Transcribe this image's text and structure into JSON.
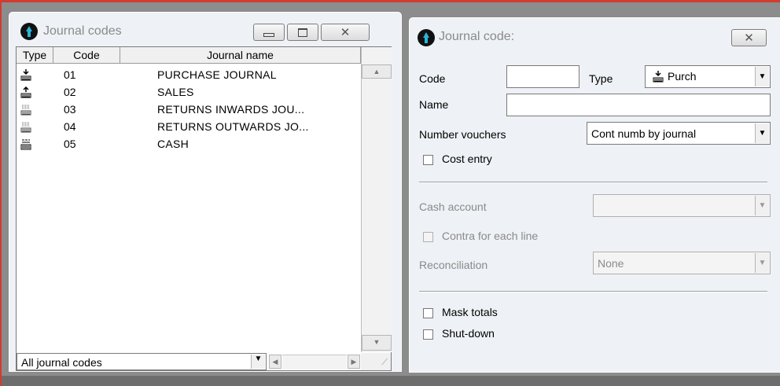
{
  "left_window": {
    "title": "Journal codes",
    "columns": [
      "Type",
      "Code",
      "Journal name"
    ],
    "rows": [
      {
        "icon": "purchase-icon",
        "code": "01",
        "name": "PURCHASE JOURNAL"
      },
      {
        "icon": "sales-icon",
        "code": "02",
        "name": "SALES"
      },
      {
        "icon": "returns-icon",
        "code": "03",
        "name": "RETURNS INWARDS JOU..."
      },
      {
        "icon": "returns-icon",
        "code": "04",
        "name": "RETURNS OUTWARDS JO..."
      },
      {
        "icon": "cash-icon",
        "code": "05",
        "name": "CASH"
      }
    ],
    "filter": "All journal codes"
  },
  "right_window": {
    "title": "Journal code:",
    "code_label": "Code",
    "code_value": "",
    "type_label": "Type",
    "type_value": "Purch",
    "name_label": "Name",
    "name_value": "",
    "number_vouchers_label": "Number vouchers",
    "number_vouchers_value": "Cont numb by journal",
    "cost_entry_label": "Cost entry",
    "cash_account_label": "Cash account",
    "cash_account_value": "",
    "contra_label": "Contra for each line",
    "reconciliation_label": "Reconciliation",
    "reconciliation_value": "None",
    "mask_totals_label": "Mask totals",
    "shutdown_label": "Shut-down"
  }
}
